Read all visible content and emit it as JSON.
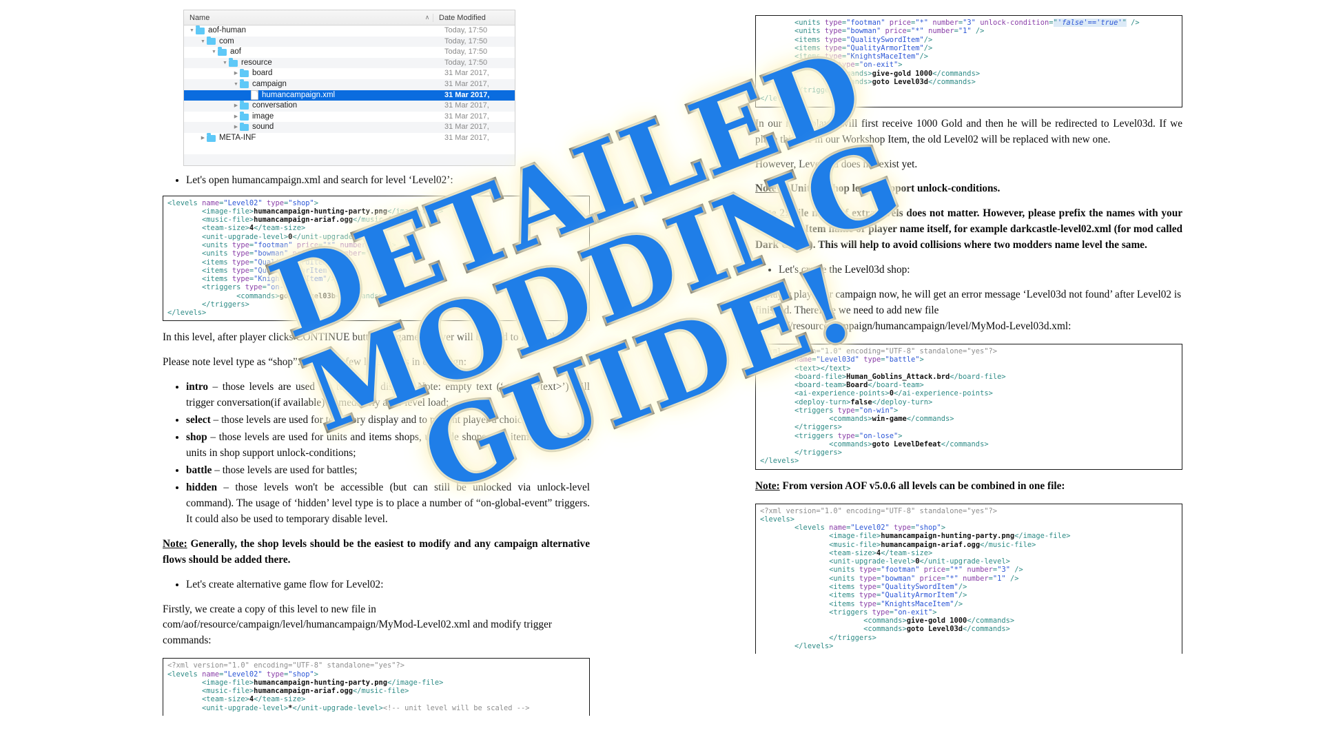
{
  "watermark": {
    "line1": "DETAILED MODDING",
    "line2": "GUIDE!",
    "color": "#1f7ee8"
  },
  "file_browser": {
    "columns": {
      "name": "Name",
      "date_modified": "Date Modified",
      "sort_indicator": "∧"
    },
    "rows": [
      {
        "name": "aof-human",
        "date": "Today, 17:50",
        "type": "folder",
        "state": "open",
        "depth": 0,
        "selected": false
      },
      {
        "name": "com",
        "date": "Today, 17:50",
        "type": "folder",
        "state": "open",
        "depth": 1,
        "selected": false
      },
      {
        "name": "aof",
        "date": "Today, 17:50",
        "type": "folder",
        "state": "open",
        "depth": 2,
        "selected": false
      },
      {
        "name": "resource",
        "date": "Today, 17:50",
        "type": "folder",
        "state": "open",
        "depth": 3,
        "selected": false
      },
      {
        "name": "board",
        "date": "31 Mar 2017,",
        "type": "folder",
        "state": "closed",
        "depth": 4,
        "selected": false
      },
      {
        "name": "campaign",
        "date": "31 Mar 2017,",
        "type": "folder",
        "state": "open",
        "depth": 4,
        "selected": false
      },
      {
        "name": "humancampaign.xml",
        "date": "31 Mar 2017,",
        "type": "file",
        "state": "none",
        "depth": 5,
        "selected": true
      },
      {
        "name": "conversation",
        "date": "31 Mar 2017,",
        "type": "folder",
        "state": "closed",
        "depth": 4,
        "selected": false
      },
      {
        "name": "image",
        "date": "31 Mar 2017,",
        "type": "folder",
        "state": "closed",
        "depth": 4,
        "selected": false
      },
      {
        "name": "sound",
        "date": "31 Mar 2017,",
        "type": "folder",
        "state": "closed",
        "depth": 4,
        "selected": false
      },
      {
        "name": "META-INF",
        "date": "31 Mar 2017,",
        "type": "folder",
        "state": "closed",
        "depth": 1,
        "selected": false
      }
    ]
  },
  "left": {
    "bullet_open_file": "Let's open humancampaign.xml and search for level ‘Level02’:",
    "para_continue": "In this level, after player clicks CONTINUE button (in game), player will be send to level03b.",
    "para_leveltypes": "Please note level type as “shop”.  There are few level types in campaign:",
    "level_types": [
      {
        "term": "intro",
        "desc": " – those levels are used for text/story display. Note: empty text (‘<text></text>’) will trigger conversation(if available) immediately after level load;"
      },
      {
        "term": "select",
        "desc": " – those levels are used for text/story display and to present player a choice;"
      },
      {
        "term": "shop",
        "desc": " – those levels are used for units and items shops, upgrade shops, and items shops. Note: units in shop support unlock-conditions;"
      },
      {
        "term": "battle",
        "desc": " – those levels are used for battles;"
      },
      {
        "term": "hidden",
        "desc": " – those levels won't be accessible (but can still be unlocked via unlock-level command). The usage of ‘hidden’ level type is to place a number of “on-global-event” triggers. It could also be used to temporary disable level."
      }
    ],
    "note_shop": {
      "label": "Note:",
      "text": " Generally, the shop levels should be the easiest to modify and any campaign alternative flows should be added there."
    },
    "bullet_create_flow": "Let's create alternative game flow for Level02:",
    "para_firstly": "Firstly, we create a copy of this level to new file in com/aof/resource/campaign/level/humancampaign/MyMod-Level02.xml and modify trigger commands:",
    "code_level02": {
      "lines": [
        "<levels name=\"Level02\" type=\"shop\">",
        "        <image-file>humancampaign-hunting-party.png</image-file>",
        "        <music-file>humancampaign-ariaf.ogg</music-file>",
        "        <team-size>4</team-size>",
        "        <unit-upgrade-level>0</unit-upgrade-level>",
        "        <units type=\"footman\" price=\"*\" number=\"3\" />",
        "        <units type=\"bowman\" price=\"*\" number=\"1\" />",
        "        <items type=\"QualitySwordItem\"/>",
        "        <items type=\"QualityArmorItem\"/>",
        "        <items type=\"KnightsMaceItem\"/>",
        "        <triggers type=\"on-exit\">",
        "                <commands>goto Level03b</commands>",
        "        </triggers>",
        "</levels>"
      ]
    },
    "code_mymod_level02": {
      "lines": [
        "<?xml version=\"1.0\" encoding=\"UTF-8\" standalone=\"yes\"?>",
        "<levels name=\"Level02\" type=\"shop\">",
        "        <image-file>humancampaign-hunting-party.png</image-file>",
        "        <music-file>humancampaign-ariaf.ogg</music-file>",
        "        <team-size>4</team-size>",
        "        <unit-upgrade-level>*</unit-upgrade-level><!-- unit level will be scaled -->"
      ]
    }
  },
  "right": {
    "code_top": {
      "lines": [
        "        <units type=\"footman\" price=\"*\" number=\"3\" unlock-condition=\"'false'=='true'\" />",
        "        <units type=\"bowman\" price=\"*\" number=\"1\" />",
        "        <items type=\"QualitySwordItem\"/>",
        "        <items type=\"QualityArmorItem\"/>",
        "        <items type=\"KnightsMaceItem\"/>",
        "        <triggers type=\"on-exit\">",
        "                <commands>give-gold 1000</commands>",
        "                <commands>goto Level03d</commands>",
        "        </triggers>",
        "</levels>"
      ]
    },
    "para_mod": "In our mod, player will first receive 1000 Gold and then he will be redirected to Level03d. If we place this file in our Workshop Item, the old Level02 will be replaced with new one.",
    "para_notexist": "However, Level03d does not exist yet.",
    "note1": {
      "label": "Note 1:",
      "text": " Units in shop levels support unlock-conditions."
    },
    "note2": {
      "label": "Note 2:",
      "text": " File name of extra levels does not matter. However, please prefix the names with your Workshop Item name or player name itself, for example darkcastle-level02.xml (for mod called Dark Castle). This will help to avoid collisions where two modders name level the same."
    },
    "bullet_create_level": "Let's create the Level03d shop:",
    "para_error": "If player plays our campaign now, he will get an error message ‘Level03d not found’ after Level02 is finished. Therefore we need to add new file com/aof/resource/campaign/humancampaign/level/MyMod-Level03d.xml:",
    "code_level03d": {
      "lines": [
        "<?xml version=\"1.0\" encoding=\"UTF-8\" standalone=\"yes\"?>",
        "<levels name=\"Level03d\" type=\"battle\">",
        "        <text></text>",
        "        <board-file>Human_Goblins_Attack.brd</board-file>",
        "        <board-team>Board</board-team>",
        "        <ai-experience-points>0</ai-experience-points>",
        "        <deploy-turn>false</deploy-turn>",
        "        <triggers type=\"on-win\">",
        "                <commands>win-game</commands>",
        "        </triggers>",
        "        <triggers type=\"on-lose\">",
        "                <commands>goto LevelDefeat</commands>",
        "        </triggers>",
        "</levels>"
      ]
    },
    "note_combined": {
      "label": "Note:",
      "text": " From version AOF v5.0.6 all levels can be combined in one file:"
    },
    "code_combined": {
      "lines": [
        "<?xml version=\"1.0\" encoding=\"UTF-8\" standalone=\"yes\"?>",
        "<levels>",
        "        <levels name=\"Level02\" type=\"shop\">",
        "                <image-file>humancampaign-hunting-party.png</image-file>",
        "                <music-file>humancampaign-ariaf.ogg</music-file>",
        "                <team-size>4</team-size>",
        "                <unit-upgrade-level>0</unit-upgrade-level>",
        "                <units type=\"footman\" price=\"*\" number=\"3\" />",
        "                <units type=\"bowman\" price=\"*\" number=\"1\" />",
        "                <items type=\"QualitySwordItem\"/>",
        "                <items type=\"QualityArmorItem\"/>",
        "                <items type=\"KnightsMaceItem\"/>",
        "                <triggers type=\"on-exit\">",
        "                        <commands>give-gold 1000</commands>",
        "                        <commands>goto Level03d</commands>",
        "                </triggers>",
        "        </levels>"
      ]
    }
  }
}
